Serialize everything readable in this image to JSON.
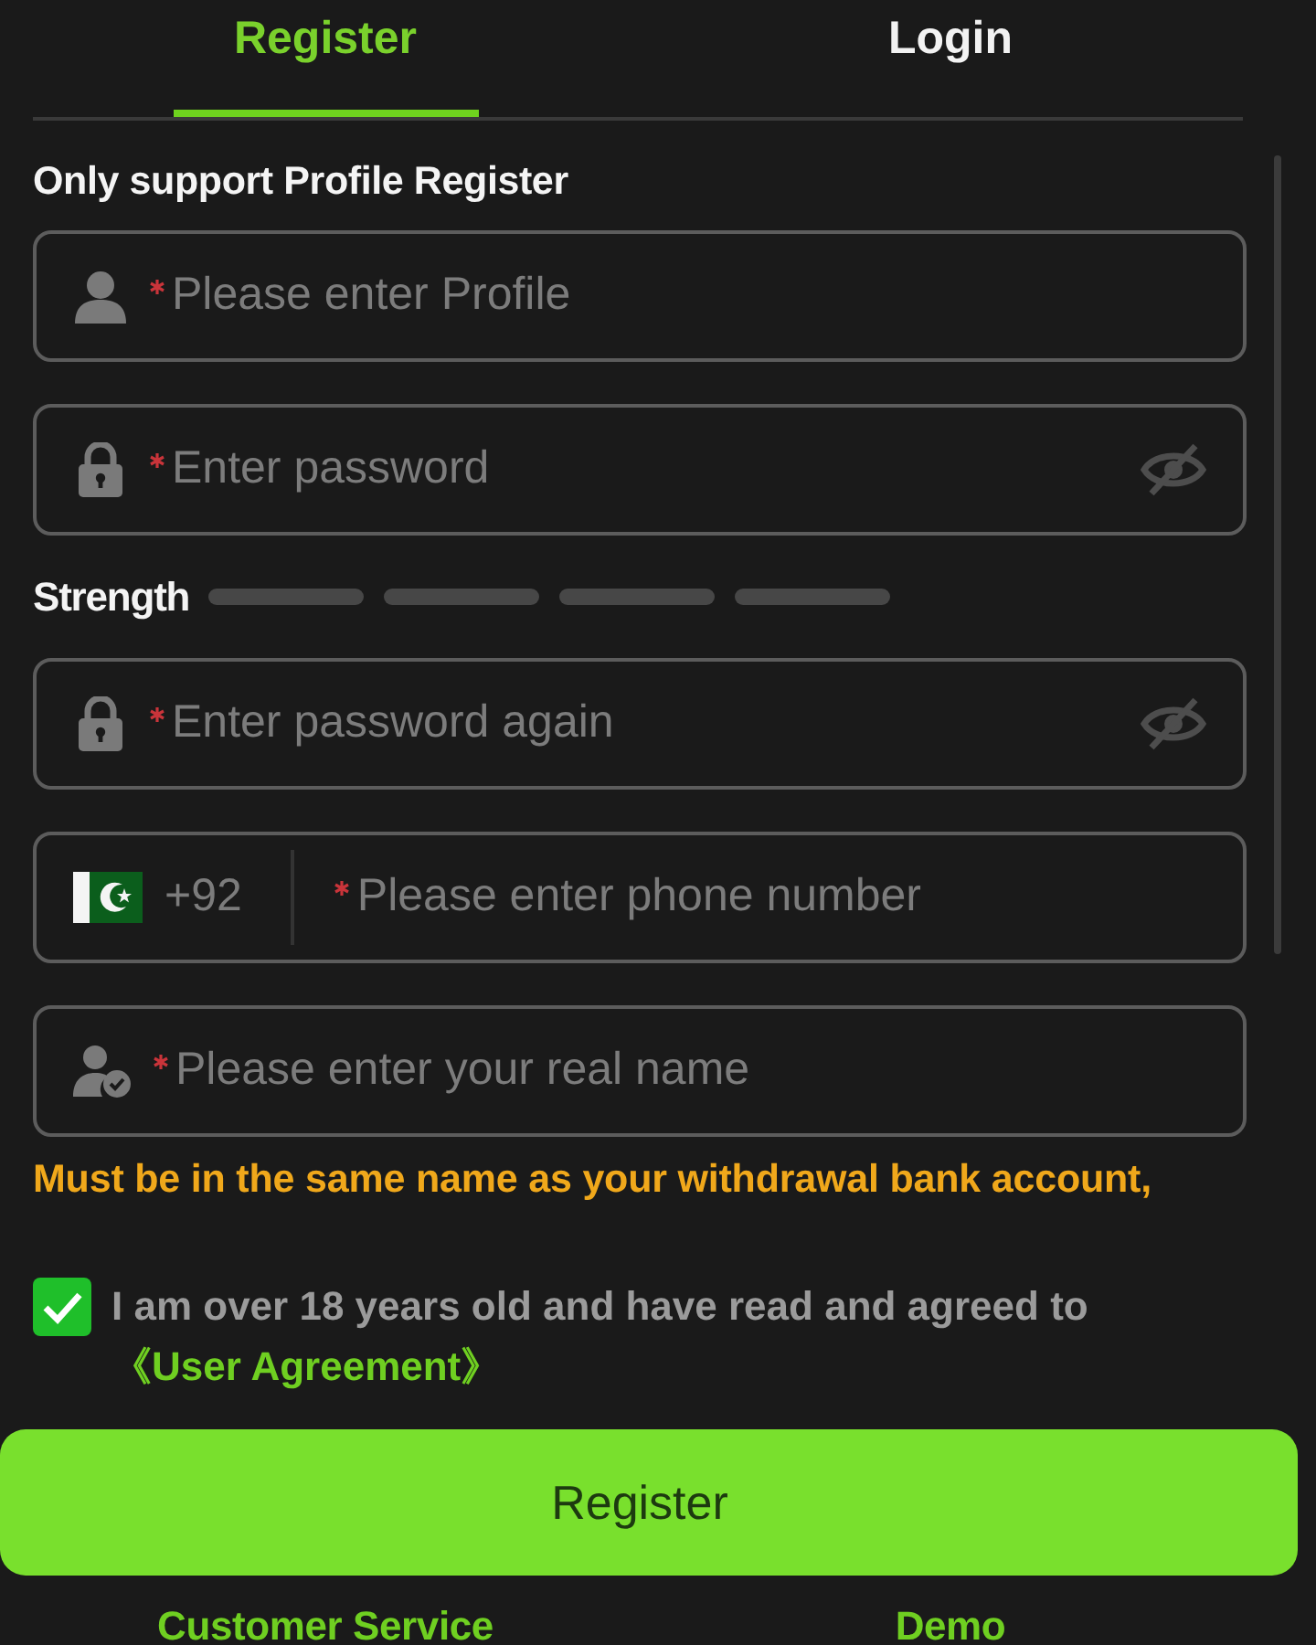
{
  "tabs": [
    {
      "label": "Register",
      "selected": true
    },
    {
      "label": "Login",
      "selected": false
    }
  ],
  "form": {
    "notice": "Only support Profile Register",
    "fields": [
      {
        "kind": "profile",
        "required": true,
        "placeholder": "Please enter Profile"
      },
      {
        "kind": "password",
        "required": true,
        "placeholder": "Enter password",
        "password_visible": false
      },
      {
        "kind": "strength",
        "label": "Strength",
        "segments": [
          {
            "filled": false
          },
          {
            "filled": false
          },
          {
            "filled": false
          },
          {
            "filled": false
          }
        ]
      },
      {
        "kind": "password",
        "required": true,
        "placeholder": "Enter password again",
        "password_visible": false
      },
      {
        "kind": "phone",
        "required": true,
        "country_code": "+92",
        "placeholder": "Please enter phone number"
      },
      {
        "kind": "real_name",
        "required": true,
        "placeholder": "Please enter your real name",
        "hint": "Must be in the same name as your withdrawal bank account,"
      }
    ]
  },
  "agreement": {
    "checked": true,
    "text": "I am over 18 years old and have read and agreed to",
    "link": "《User Agreement》"
  },
  "submit_button": "Register",
  "footer_links": [
    "Customer Service",
    "Demo"
  ]
}
